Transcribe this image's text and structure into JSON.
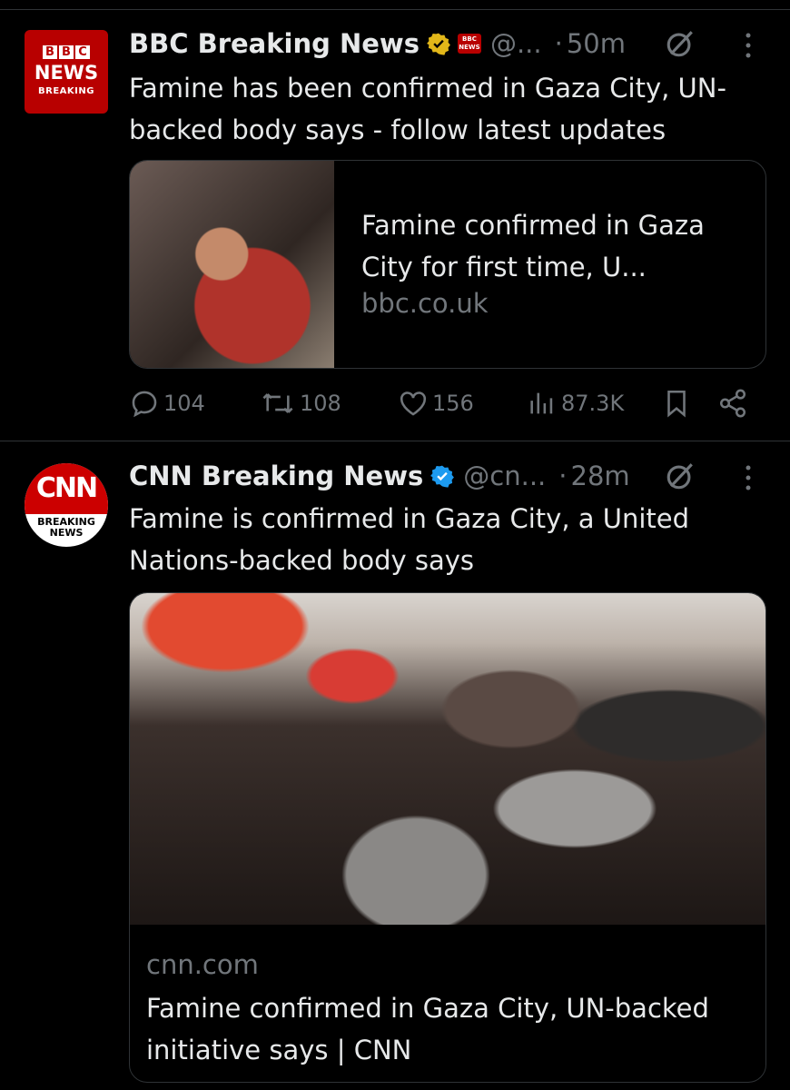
{
  "tweets": [
    {
      "name": "BBC Breaking News",
      "handle": "@...",
      "dot": "·",
      "time": "50m",
      "avatar": {
        "boxes": [
          "B",
          "B",
          "C"
        ],
        "news": "NEWS",
        "sub": "BREAKING"
      },
      "text": "Famine has been confirmed in Gaza City, UN-backed body says - follow latest updates",
      "card": {
        "title": "Famine confirmed in Gaza City for first time, U...",
        "domain": "bbc.co.uk"
      },
      "stats": {
        "replies": "104",
        "reposts": "108",
        "likes": "156",
        "views": "87.3K"
      }
    },
    {
      "name": "CNN Breaking News",
      "handle": "@cn...",
      "dot": "·",
      "time": "28m",
      "avatar": {
        "logo": "CNN",
        "sub1": "BREAKING",
        "sub2": "NEWS"
      },
      "text": "Famine is confirmed in Gaza City, a United Nations-backed body says",
      "card": {
        "domain": "cnn.com",
        "title": "Famine confirmed in Gaza City, UN-backed initiative says | CNN"
      }
    }
  ],
  "colors": {
    "background": "#000000",
    "text": "#e7e9ea",
    "muted": "#71767b",
    "gold_badge": "#e2b719",
    "blue_badge": "#1d9bf0",
    "bbc_red": "#b80000",
    "cnn_red": "#cc0000"
  },
  "icons": [
    "grok-icon",
    "more-icon",
    "reply-icon",
    "repost-icon",
    "like-icon",
    "views-icon",
    "bookmark-icon",
    "share-icon",
    "verified-gold-icon",
    "verified-blue-icon"
  ]
}
